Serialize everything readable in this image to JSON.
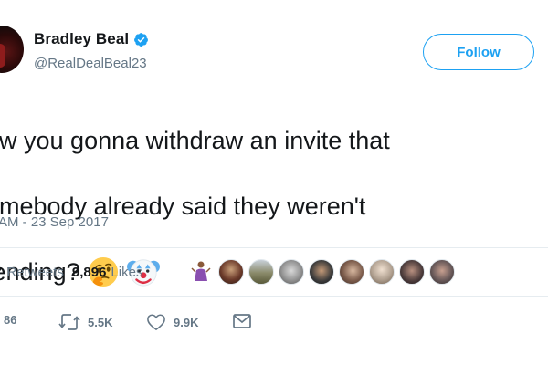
{
  "user": {
    "display_name": "Bradley Beal",
    "handle": "@RealDealBeal23",
    "verified_icon": "verified-badge-icon"
  },
  "follow_button": {
    "label": "Follow"
  },
  "tweet": {
    "text_lines": [
      "ow you gonna withdraw an invite that",
      "omebody already said they weren't",
      "tending?"
    ],
    "emojis": [
      "thinking-face-emoji",
      "clown-face-emoji"
    ],
    "timestamp": "AM - 23 Sep 2017"
  },
  "stats": {
    "retweets_count": "7",
    "retweets_label": "Retweets",
    "likes_count": "9,896",
    "likes_label": "Likes"
  },
  "likers": [
    {
      "name": "liker-avatar-1",
      "color": "#ffffff"
    },
    {
      "name": "liker-avatar-2",
      "color": "#6b3a2a"
    },
    {
      "name": "liker-avatar-3",
      "color": "#8a8a6a"
    },
    {
      "name": "liker-avatar-4",
      "color": "#9a9a9a"
    },
    {
      "name": "liker-avatar-5",
      "color": "#3a3a3a"
    },
    {
      "name": "liker-avatar-6",
      "color": "#7a5a4a"
    },
    {
      "name": "liker-avatar-7",
      "color": "#b0a090"
    },
    {
      "name": "liker-avatar-8",
      "color": "#4a3a3a"
    },
    {
      "name": "liker-avatar-9",
      "color": "#6a5a5a"
    }
  ],
  "actions": {
    "reply_count": "86",
    "retweet_count": "5.5K",
    "like_count": "9.9K"
  },
  "colors": {
    "accent": "#1da1f2",
    "text_primary": "#14171a",
    "text_secondary": "#657786",
    "divider": "#e6ecf0"
  }
}
